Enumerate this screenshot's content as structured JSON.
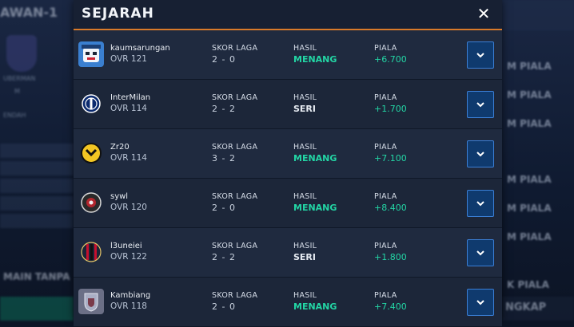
{
  "background": {
    "left_title": "AWAN-1",
    "left_label_a": "UBERMAN",
    "left_label_b": "M",
    "left_label_c": "ENDAH",
    "left_bottom": "MAIN TANPA",
    "right_items": [
      "M PIALA",
      "M PIALA",
      "M PIALA",
      "M PIALA",
      "M PIALA",
      "M PIALA",
      "K PIALA"
    ],
    "right_bottom": "NGKAP"
  },
  "modal": {
    "title": "SEJARAH",
    "close_symbol": "✕"
  },
  "matches": [
    {
      "opponent": "kaumsarungan",
      "ovr": "OVR 121",
      "score_label": "SKOR LAGA",
      "score": "2 - 0",
      "result_label": "HASIL",
      "result": "MENANG",
      "result_type": "win",
      "trophy_label": "PIALA",
      "trophies": "+6.700",
      "badge": "mascot-badge-icon"
    },
    {
      "opponent": "InterMilan",
      "ovr": "OVR 114",
      "score_label": "SKOR LAGA",
      "score": "2 - 2",
      "result_label": "HASIL",
      "result": "SERI",
      "result_type": "draw",
      "trophy_label": "PIALA",
      "trophies": "+1.700",
      "badge": "inter-crest-icon"
    },
    {
      "opponent": "Zr20",
      "ovr": "OVR 114",
      "score_label": "SKOR LAGA",
      "score": "3 - 2",
      "result_label": "HASIL",
      "result": "MENANG",
      "result_type": "win",
      "trophy_label": "PIALA",
      "trophies": "+7.100",
      "badge": "yb-crest-icon"
    },
    {
      "opponent": "sywl",
      "ovr": "OVR 120",
      "score_label": "SKOR LAGA",
      "score": "2 - 0",
      "result_label": "HASIL",
      "result": "MENANG",
      "result_type": "win",
      "trophy_label": "PIALA",
      "trophies": "+8.400",
      "badge": "round-crest-icon"
    },
    {
      "opponent": "l3uneiei",
      "ovr": "OVR 122",
      "score_label": "SKOR LAGA",
      "score": "2 - 2",
      "result_label": "HASIL",
      "result": "SERI",
      "result_type": "draw",
      "trophy_label": "PIALA",
      "trophies": "+1.800",
      "badge": "milan-crest-icon"
    },
    {
      "opponent": "Kambiang",
      "ovr": "OVR 118",
      "score_label": "SKOR LAGA",
      "score": "2 - 0",
      "result_label": "HASIL",
      "result": "MENANG",
      "result_type": "win",
      "trophy_label": "PIALA",
      "trophies": "+7.400",
      "badge": "shield-crest-icon"
    }
  ],
  "colors": {
    "win": "#23d6a5",
    "accent_line": "#d97a2a",
    "button_border": "#3b7fd6"
  }
}
